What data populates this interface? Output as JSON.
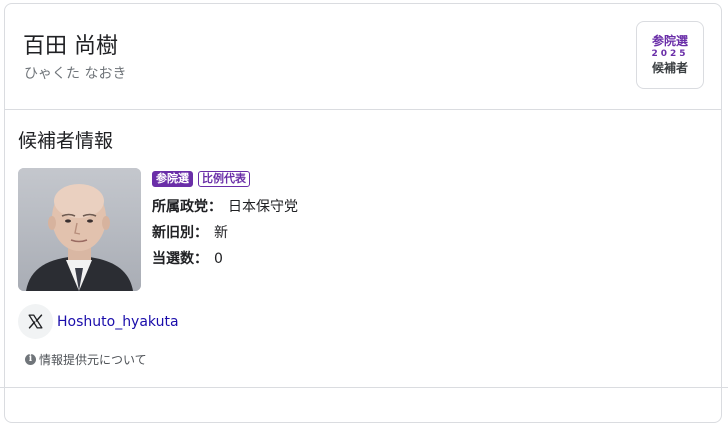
{
  "candidate": {
    "name": "百田 尚樹",
    "kana": "ひゃくた なおき"
  },
  "election_badge": {
    "top": "参院選",
    "year": "2025",
    "bottom": "候補者",
    "accent_color": "#6a2ea8"
  },
  "section": {
    "title": "候補者情報"
  },
  "tags": [
    "参院選",
    "比例代表"
  ],
  "details": [
    {
      "label": "所属政党：",
      "value": "日本保守党"
    },
    {
      "label": "新旧別：",
      "value": "新"
    },
    {
      "label": "当選数：",
      "value": "0"
    }
  ],
  "social": {
    "icon": "x-icon",
    "handle": "Hoshuto_hyakuta"
  },
  "source_note": "情報提供元について",
  "colors": {
    "link": "#1a0dab",
    "border": "#dadce0",
    "secondary_text": "#70757a"
  }
}
